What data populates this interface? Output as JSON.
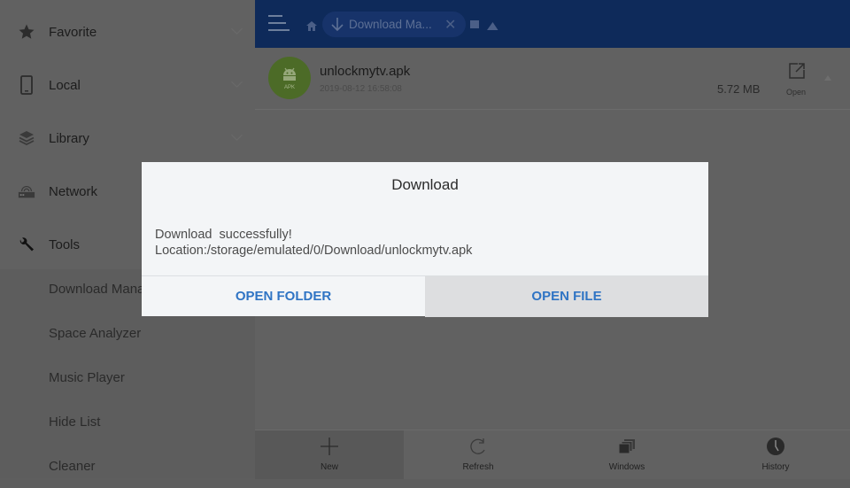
{
  "sidebar": {
    "items": [
      {
        "label": "Favorite",
        "icon": "star-icon"
      },
      {
        "label": "Local",
        "icon": "phone-icon"
      },
      {
        "label": "Library",
        "icon": "layers-icon"
      },
      {
        "label": "Network",
        "icon": "router-icon"
      },
      {
        "label": "Tools",
        "icon": "wrench-icon"
      }
    ],
    "tools_sub": [
      {
        "label": "Download Manager"
      },
      {
        "label": "Space Analyzer"
      },
      {
        "label": "Music Player"
      },
      {
        "label": "Hide List"
      },
      {
        "label": "Cleaner"
      }
    ]
  },
  "topbar": {
    "breadcrumb_label": "Download Ma...",
    "close_glyph": "✕"
  },
  "file": {
    "name": "unlockmytv.apk",
    "date": "2019-08-12 16:58:08",
    "size": "5.72 MB",
    "icon_tag": "APK",
    "open_label": "Open"
  },
  "bottombar": {
    "buttons": [
      {
        "label": "New",
        "icon": "plus-icon"
      },
      {
        "label": "Refresh",
        "icon": "refresh-icon"
      },
      {
        "label": "Windows",
        "icon": "windows-icon"
      },
      {
        "label": "History",
        "icon": "clock-icon"
      }
    ]
  },
  "dialog": {
    "title": "Download",
    "message_line1": "Download  successfully!",
    "message_line2": "Location:/storage/emulated/0/Download/unlockmytv.apk",
    "open_folder": "OPEN FOLDER",
    "open_file": "OPEN FILE"
  },
  "colors": {
    "accent": "#2f74c4",
    "topbar": "#0e2a5a",
    "apk_green": "#4c6b27"
  }
}
